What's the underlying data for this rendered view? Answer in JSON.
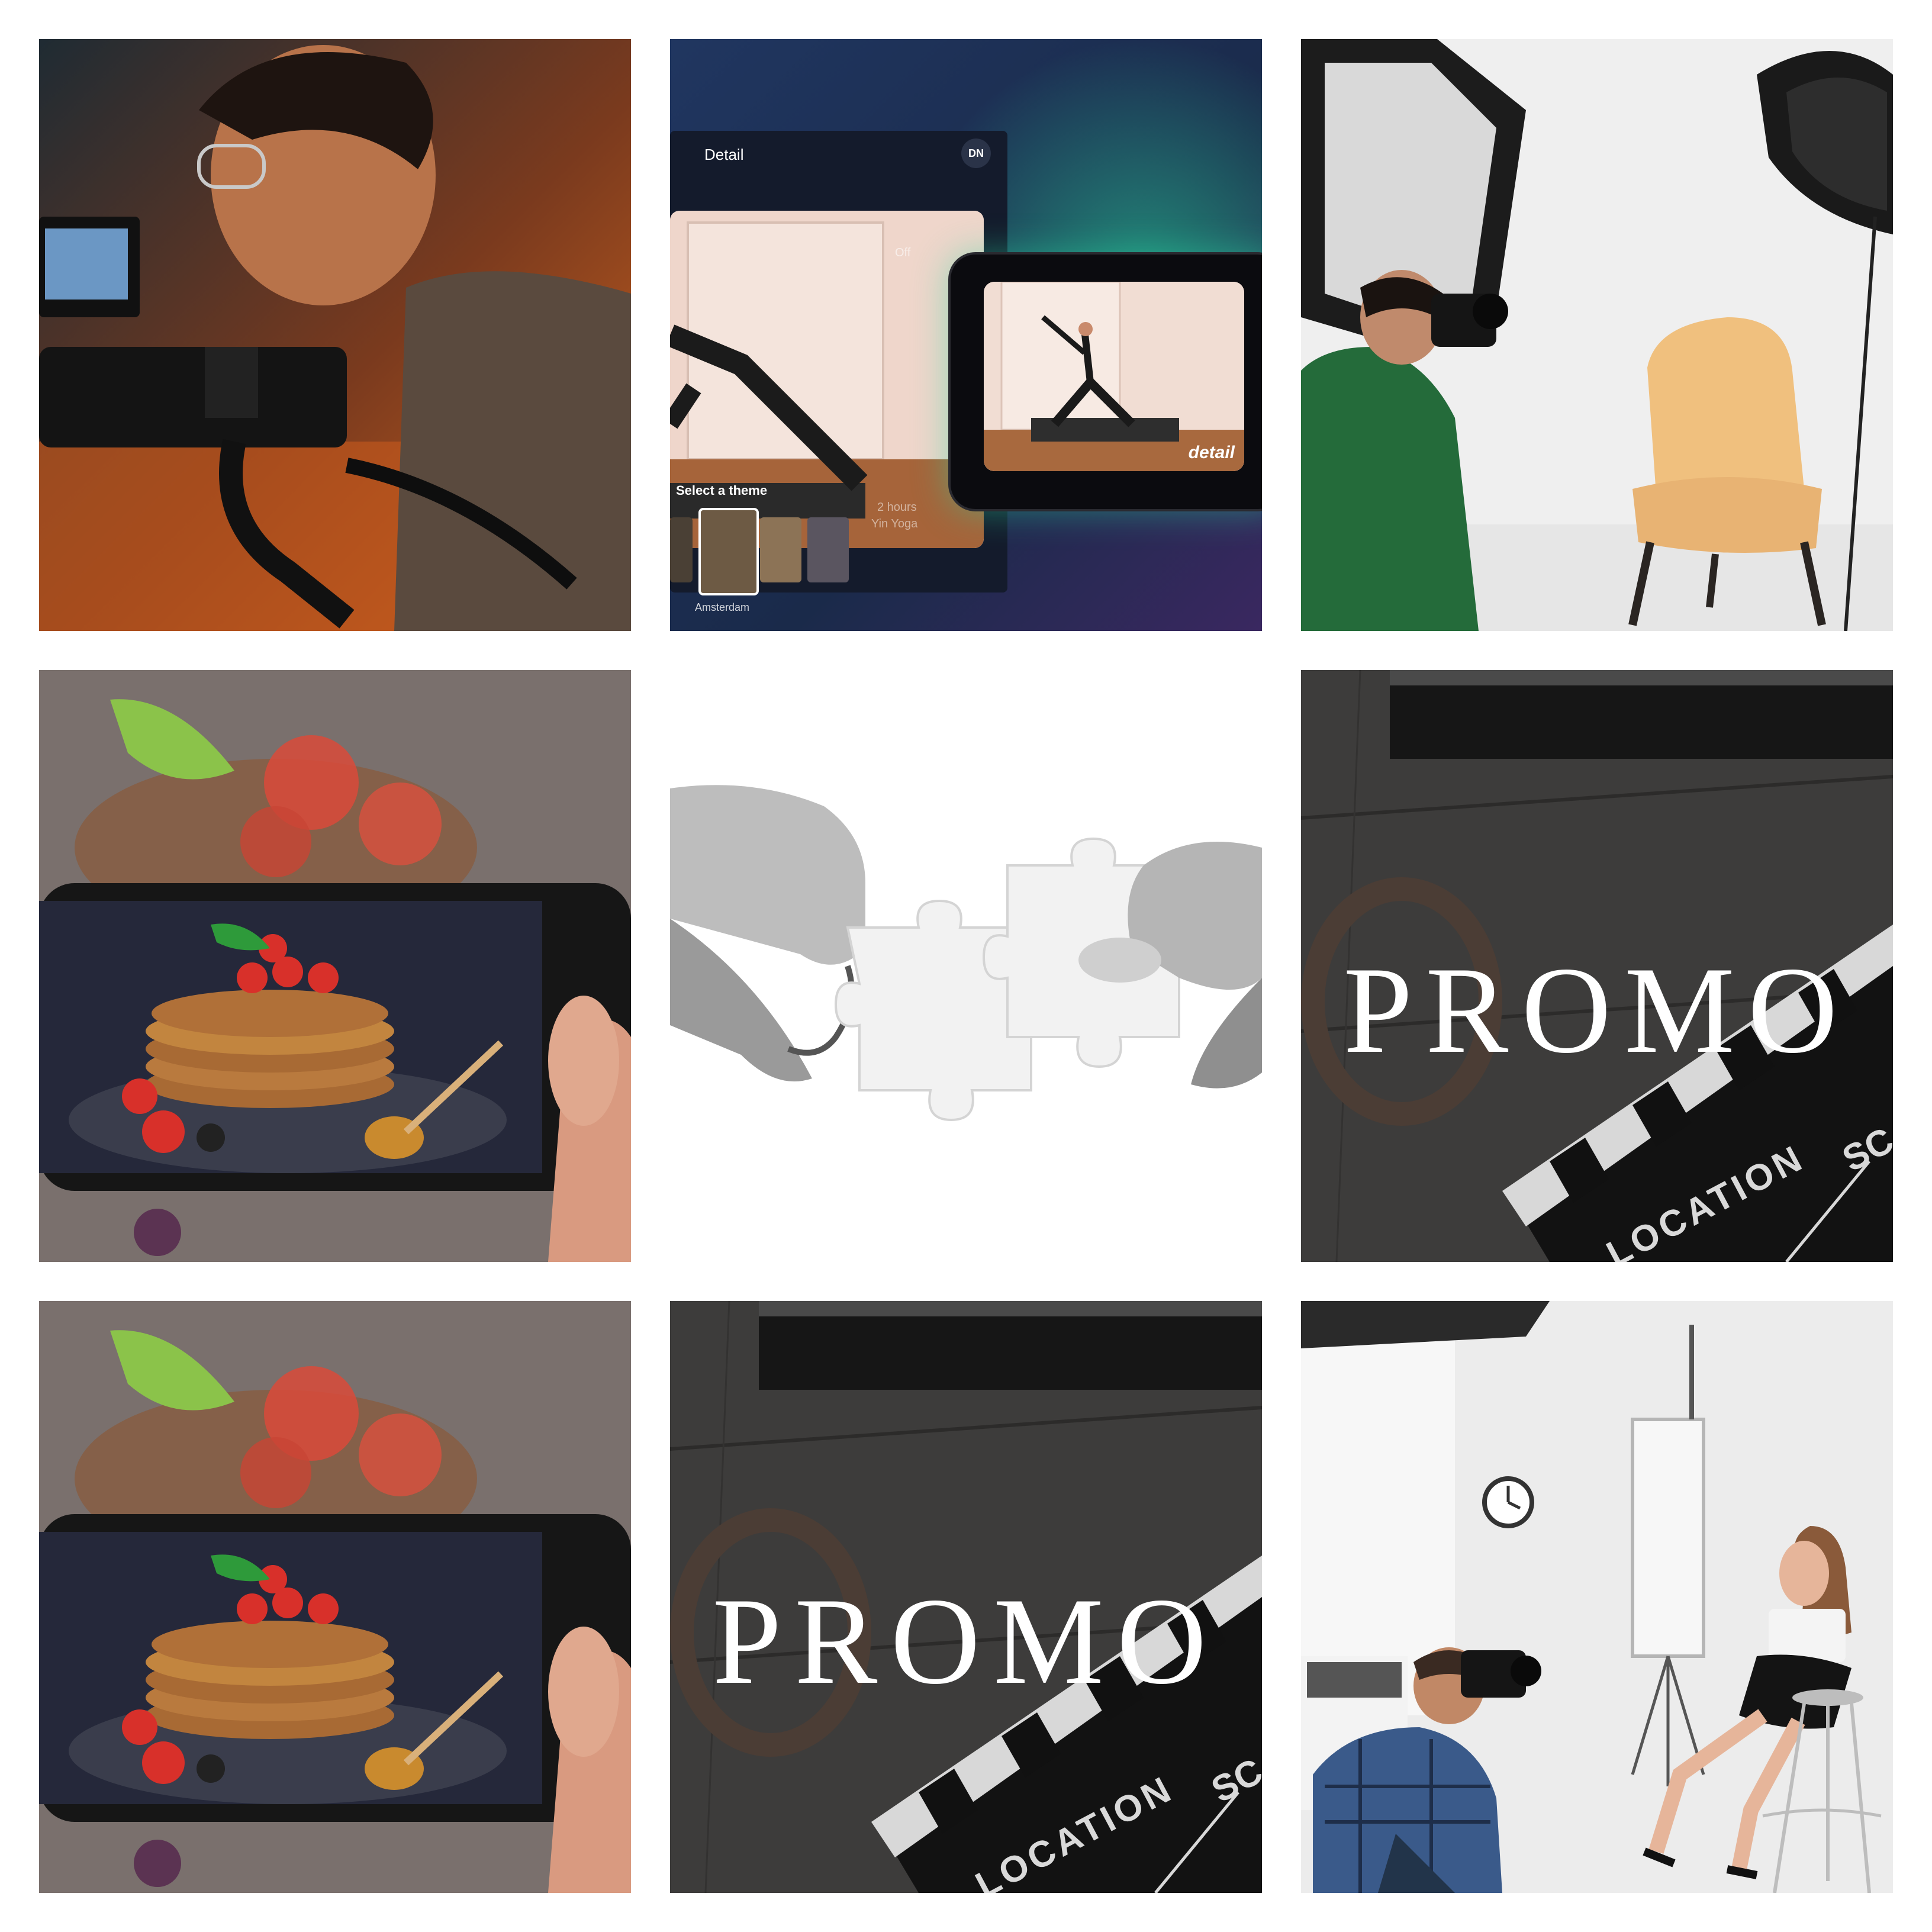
{
  "grid": {
    "background": "#ffffff",
    "tiles": [
      {
        "id": "videographer",
        "scene": "camera-operator"
      },
      {
        "id": "yoga-app",
        "scene": "app-mockup"
      },
      {
        "id": "photo-studio-chair",
        "scene": "photographer-chair"
      },
      {
        "id": "food-phone-1",
        "scene": "pancakes-phone"
      },
      {
        "id": "puzzle",
        "scene": "puzzle-hands"
      },
      {
        "id": "promo-1",
        "scene": "clapperboard"
      },
      {
        "id": "food-phone-2",
        "scene": "pancakes-phone"
      },
      {
        "id": "promo-2",
        "scene": "clapperboard"
      },
      {
        "id": "photo-studio-model",
        "scene": "photographer-model"
      }
    ]
  },
  "yoga_app": {
    "header_title": "Detail",
    "avatar_initials": "DN",
    "theme_heading": "Select a theme",
    "theme_selected": "Amsterdam",
    "duration": "2 hours",
    "subtitle": "Yin Yoga",
    "toggle": "Off",
    "brand_overlay": "detail",
    "accent": "#2bd6a0"
  },
  "promo_1": {
    "title": "PROMO",
    "clapper_location": "LOCATION",
    "clapper_scene": "SC"
  },
  "promo_2": {
    "title": "PROMO",
    "clapper_location": "LOCATION",
    "clapper_scene": "SC"
  }
}
